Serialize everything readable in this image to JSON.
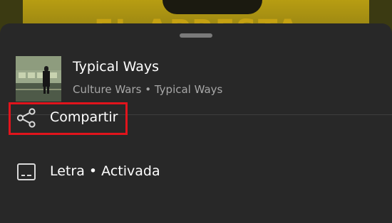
{
  "backdrop": {
    "poster_text": "EL APRESTA"
  },
  "track": {
    "title": "Typical Ways",
    "artist": "Culture Wars",
    "separator": "•",
    "album": "Typical Ways"
  },
  "menu": {
    "share": {
      "label": "Compartir",
      "icon": "share-icon"
    },
    "lyrics": {
      "label": "Letra",
      "separator": "•",
      "state": "Activada",
      "icon": "lyrics-icon"
    }
  },
  "colors": {
    "sheet": "#282828",
    "highlight": "#e1141c",
    "subtext": "#a7a7a7"
  }
}
